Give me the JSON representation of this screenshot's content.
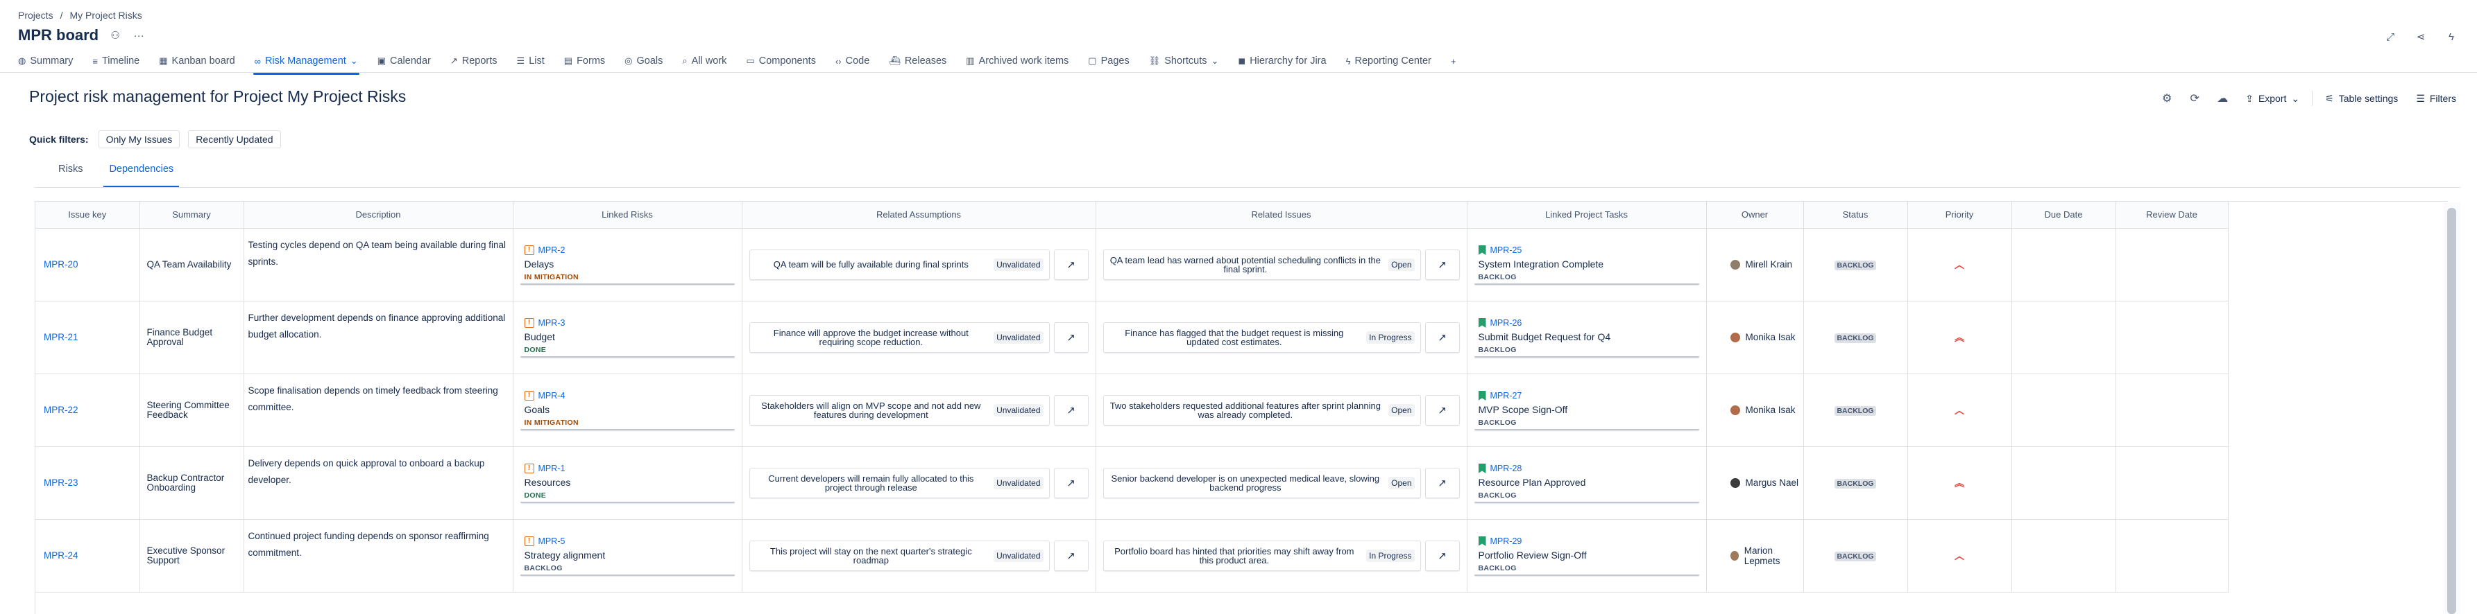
{
  "breadcrumb": {
    "projects": "Projects",
    "sep": "/",
    "project": "My Project Risks"
  },
  "board": {
    "title": "MPR board"
  },
  "nav": [
    {
      "icon": "globe-icon",
      "glyph": "◍",
      "label": "Summary"
    },
    {
      "icon": "timeline-icon",
      "glyph": "≡",
      "label": "Timeline"
    },
    {
      "icon": "board-icon",
      "glyph": "▦",
      "label": "Kanban board"
    },
    {
      "icon": "link-icon",
      "glyph": "∞",
      "label": "Risk Management",
      "chev": "⌄"
    },
    {
      "icon": "calendar-icon",
      "glyph": "▣",
      "label": "Calendar"
    },
    {
      "icon": "reports-icon",
      "glyph": "↗",
      "label": "Reports"
    },
    {
      "icon": "list-icon",
      "glyph": "☰",
      "label": "List"
    },
    {
      "icon": "forms-icon",
      "glyph": "▤",
      "label": "Forms"
    },
    {
      "icon": "goals-icon",
      "glyph": "◎",
      "label": "Goals"
    },
    {
      "icon": "all-work-icon",
      "glyph": "⌕",
      "label": "All work"
    },
    {
      "icon": "components-icon",
      "glyph": "▭",
      "label": "Components"
    },
    {
      "icon": "code-icon",
      "glyph": "‹›",
      "label": "Code"
    },
    {
      "icon": "releases-icon",
      "glyph": "⛴",
      "label": "Releases"
    },
    {
      "icon": "archive-icon",
      "glyph": "▥",
      "label": "Archived work items"
    },
    {
      "icon": "pages-icon",
      "glyph": "▢",
      "label": "Pages"
    },
    {
      "icon": "shortcuts-icon",
      "glyph": "⛓",
      "label": "Shortcuts",
      "chev": "⌄"
    },
    {
      "icon": "hierarchy-icon",
      "glyph": "◼",
      "label": "Hierarchy for Jira"
    },
    {
      "icon": "reporting-center-icon",
      "glyph": "ϟ",
      "label": "Reporting Center"
    },
    {
      "icon": "add-icon",
      "glyph": "+",
      "label": ""
    }
  ],
  "page": {
    "title": "Project risk management for Project My Project Risks"
  },
  "toolbar": {
    "export": "Export",
    "table_settings": "Table settings",
    "filters": "Filters"
  },
  "quick_filters": {
    "label": "Quick filters:",
    "f1": "Only My Issues",
    "f2": "Recently Updated"
  },
  "subtabs": {
    "risks": "Risks",
    "dependencies": "Dependencies"
  },
  "columns": [
    "Issue key",
    "Summary",
    "Description",
    "Linked Risks",
    "Related Assumptions",
    "Related Issues",
    "Linked Project Tasks",
    "Owner",
    "Status",
    "Priority",
    "Due Date",
    "Review Date"
  ],
  "rows": [
    {
      "key": "MPR-20",
      "summary": "QA Team Availability",
      "desc": "Testing cycles depend on QA team being available during final sprints.",
      "risk": {
        "key": "MPR-2",
        "title": "Delays",
        "status": "IN MITIGATION"
      },
      "assumption": {
        "text": "QA team will be fully available during final sprints",
        "status": "Unvalidated"
      },
      "issue": {
        "text": "QA team lead has warned about potential scheduling conflicts in the final sprint.",
        "status": "Open"
      },
      "task": {
        "key": "MPR-25",
        "title": "System Integration Complete",
        "status": "BACKLOG"
      },
      "owner": "Mirell Krain",
      "status": "BACKLOG",
      "priority": "medium-priority-icon"
    },
    {
      "key": "MPR-21",
      "summary": "Finance Budget Approval",
      "desc": "Further development depends on finance approving additional budget allocation.",
      "risk": {
        "key": "MPR-3",
        "title": "Budget",
        "status": "DONE"
      },
      "assumption": {
        "text": "Finance will approve the budget increase without requiring scope reduction.",
        "status": "Unvalidated"
      },
      "issue": {
        "text": "Finance has flagged that the budget request is missing updated cost estimates.",
        "status": "In Progress"
      },
      "task": {
        "key": "MPR-26",
        "title": "Submit Budget Request for Q4",
        "status": "BACKLOG"
      },
      "owner": "Monika Isak",
      "status": "BACKLOG",
      "priority": "highest-priority-icon"
    },
    {
      "key": "MPR-22",
      "summary": "Steering Committee Feedback",
      "desc": "Scope finalisation depends on timely feedback from steering committee.",
      "risk": {
        "key": "MPR-4",
        "title": "Goals",
        "status": "IN MITIGATION"
      },
      "assumption": {
        "text": "Stakeholders will align on MVP scope and not add new features during development",
        "status": "Unvalidated"
      },
      "issue": {
        "text": "Two stakeholders requested additional features after sprint planning was already completed.",
        "status": "Open"
      },
      "task": {
        "key": "MPR-27",
        "title": "MVP Scope Sign-Off",
        "status": "BACKLOG"
      },
      "owner": "Monika Isak",
      "status": "BACKLOG",
      "priority": "medium-priority-icon"
    },
    {
      "key": "MPR-23",
      "summary": "Backup Contractor Onboarding",
      "desc": "Delivery depends on quick approval to onboard a backup developer.",
      "risk": {
        "key": "MPR-1",
        "title": "Resources",
        "status": "DONE"
      },
      "assumption": {
        "text": "Current developers will remain fully allocated to this project through release",
        "status": "Unvalidated"
      },
      "issue": {
        "text": "Senior backend developer is on unexpected medical leave, slowing backend progress",
        "status": "Open"
      },
      "task": {
        "key": "MPR-28",
        "title": "Resource Plan Approved",
        "status": "BACKLOG"
      },
      "owner": "Margus Nael",
      "status": "BACKLOG",
      "priority": "highest-priority-icon"
    },
    {
      "key": "MPR-24",
      "summary": "Executive Sponsor Support",
      "desc": "Continued project funding depends on sponsor reaffirming commitment.",
      "risk": {
        "key": "MPR-5",
        "title": "Strategy alignment",
        "status": "BACKLOG"
      },
      "assumption": {
        "text": "This project will stay on the next quarter's strategic roadmap",
        "status": "Unvalidated"
      },
      "issue": {
        "text": "Portfolio board has hinted that priorities may shift away from this product area.",
        "status": "In Progress"
      },
      "task": {
        "key": "MPR-29",
        "title": "Portfolio Review Sign-Off",
        "status": "BACKLOG"
      },
      "owner": "Marion Lepmets",
      "status": "BACKLOG",
      "priority": "medium-priority-icon"
    }
  ],
  "colors": {
    "accent": "#0c66e4",
    "risk_icon": "#e56910",
    "story_icon": "#22a06b",
    "in_mitigation": "#a54800",
    "done": "#216e4e",
    "priority": "#e2483d"
  }
}
